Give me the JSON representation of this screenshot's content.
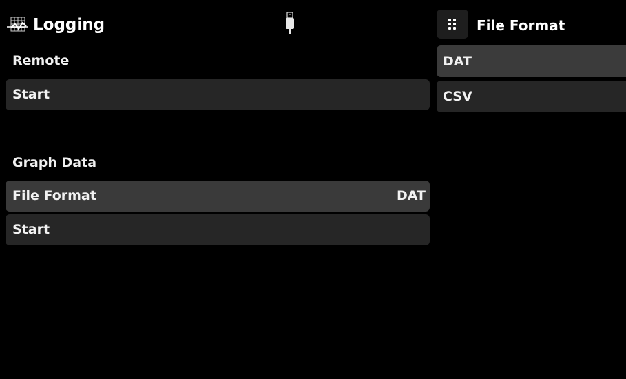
{
  "header": {
    "title": "Logging",
    "icon": "chart-grid-icon",
    "status_icon": "usb-icon"
  },
  "main": {
    "remote_label": "Remote",
    "remote_start_label": "Start",
    "graph_label": "Graph Data",
    "file_format_label": "File Format",
    "file_format_value": "DAT",
    "graph_start_label": "Start"
  },
  "panel": {
    "menu_icon": "grid-dots-icon",
    "title": "File Format",
    "options": [
      "DAT",
      "CSV"
    ],
    "selected": "DAT"
  },
  "colors": {
    "background": "#000000",
    "row": "#262626",
    "row_selected": "#3a3a3a",
    "text": "#f2f2f2"
  }
}
